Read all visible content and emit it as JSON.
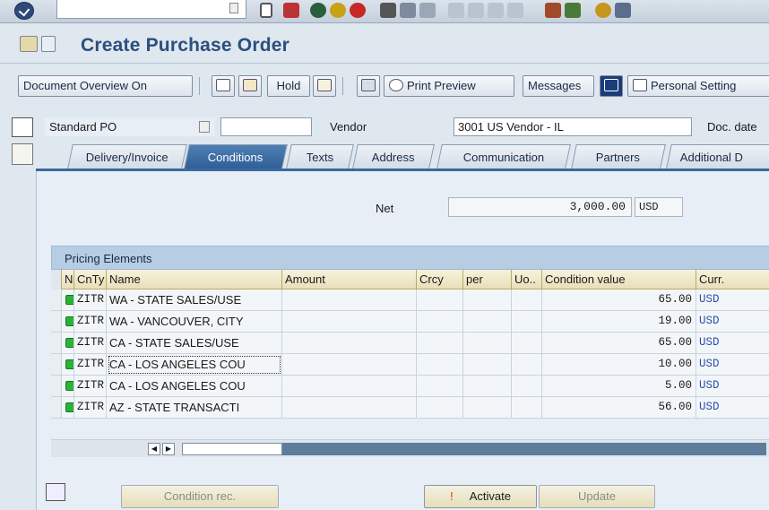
{
  "title": "Create Purchase Order",
  "toolbar": {
    "doc_overview": "Document Overview On",
    "hold": "Hold",
    "print_preview": "Print Preview",
    "messages": "Messages",
    "personal_settings": "Personal Setting"
  },
  "header": {
    "doc_type": "Standard PO",
    "vendor_label": "Vendor",
    "vendor_value": "3001 US Vendor - IL",
    "doc_date_label": "Doc. date"
  },
  "tabs": [
    "Delivery/Invoice",
    "Conditions",
    "Texts",
    "Address",
    "Communication",
    "Partners",
    "Additional D"
  ],
  "active_tab": "Conditions",
  "net": {
    "label": "Net",
    "value": "3,000.00",
    "currency": "USD"
  },
  "pricing": {
    "title": "Pricing Elements",
    "columns": [
      "N..",
      "CnTy",
      "Name",
      "Amount",
      "Crcy",
      "per",
      "Uo..",
      "Condition value",
      "Curr."
    ],
    "rows": [
      {
        "type": "ZITR",
        "name": "WA - STATE SALES/USE",
        "value": "65.00",
        "currency": "USD"
      },
      {
        "type": "ZITR",
        "name": "WA - VANCOUVER, CITY",
        "value": "19.00",
        "currency": "USD"
      },
      {
        "type": "ZITR",
        "name": "CA - STATE SALES/USE",
        "value": "65.00",
        "currency": "USD"
      },
      {
        "type": "ZITR",
        "name": "CA - LOS ANGELES COU",
        "value": "10.00",
        "currency": "USD"
      },
      {
        "type": "ZITR",
        "name": "CA - LOS ANGELES COU",
        "value": "5.00",
        "currency": "USD"
      },
      {
        "type": "ZITR",
        "name": "AZ - STATE TRANSACTI",
        "value": "56.00",
        "currency": "USD"
      }
    ]
  },
  "bottom": {
    "condition_rec": "Condition rec.",
    "activate": "Activate",
    "update": "Update"
  },
  "colors": {
    "title": "#2b4f7e",
    "active_tab": "#3a6aa0",
    "status_green": "#2cb23a"
  }
}
